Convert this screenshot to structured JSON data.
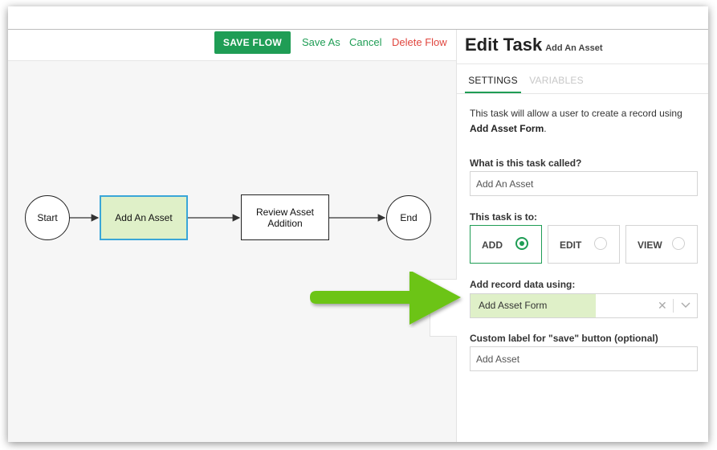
{
  "toolbar": {
    "save_flow": "SAVE FLOW",
    "save_as": "Save As",
    "cancel": "Cancel",
    "delete_flow": "Delete Flow"
  },
  "flow": {
    "nodes": {
      "start": "Start",
      "add_asset": "Add An Asset",
      "review_line1": "Review Asset",
      "review_line2": "Addition",
      "end": "End"
    }
  },
  "panel": {
    "title": "Edit Task",
    "subtitle": "Add An Asset",
    "tabs": {
      "settings": "SETTINGS",
      "variables": "VARIABLES"
    },
    "description_prefix": "This task will allow a user to create a record using",
    "description_form": "Add Asset Form",
    "description_suffix": ".",
    "task_name_label": "What is this task called?",
    "task_name_value": "Add An Asset",
    "task_type_label": "This task is to:",
    "options": {
      "add": "ADD",
      "edit": "EDIT",
      "view": "VIEW"
    },
    "selected_option": "ADD",
    "record_data_label": "Add record data using:",
    "record_data_value": "Add Asset Form",
    "save_label_label": "Custom label for \"save\" button (optional)",
    "save_label_value": "Add Asset"
  },
  "colors": {
    "accent_green": "#1f9d55",
    "delete_red": "#e0463f",
    "active_node_fill": "#dff0c8",
    "active_node_border": "#3aa6d8",
    "arrow_green": "#6cc417"
  },
  "icons": {
    "clear": "x-icon",
    "caret": "chevron-down-icon",
    "pointer": "arrow-right-icon"
  }
}
